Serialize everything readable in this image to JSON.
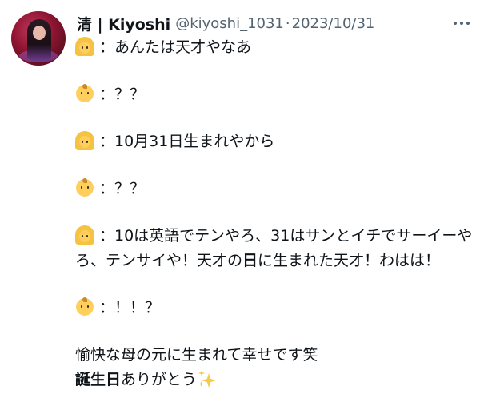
{
  "author": {
    "name": "清 | Kiyoshi",
    "handle": "@kiyoshi_1031",
    "separator": "·",
    "date": "2023/10/31"
  },
  "tweet": {
    "line1": "：あんたは天才やなあ",
    "line2": "：？？",
    "line3": "：10月31日生まれやから",
    "line4": "：？？",
    "line5": "：10は英語でテンやろ、31はサンとイチでサーイーやろ、テンサイや！天才の",
    "line5_bold": "日",
    "line5_end": "に生まれた天才！わはは！",
    "line6": "：！！？",
    "line7": "愉快な母の元に生まれて幸せです笑",
    "line8_bold": "誕生日",
    "line8": "ありがとう"
  },
  "icons": {
    "mother": "woman-emoji",
    "baby": "baby-emoji",
    "sparkles": "sparkles-emoji",
    "more": "more-icon"
  }
}
